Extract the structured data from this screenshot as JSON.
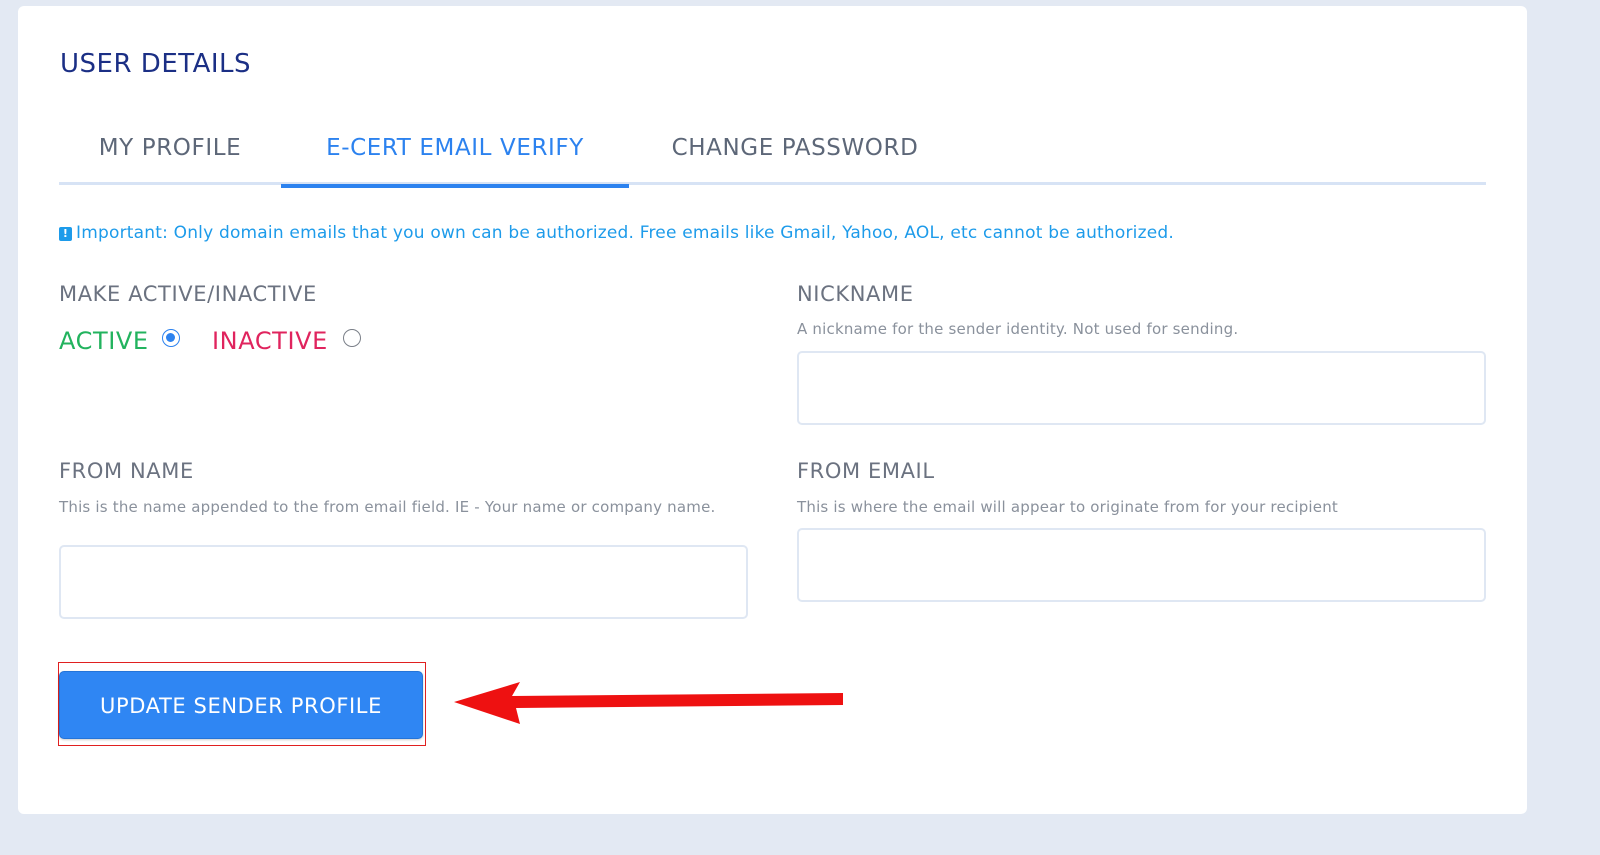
{
  "page": {
    "title": "USER DETAILS"
  },
  "tabs": [
    {
      "label": "MY PROFILE",
      "active": false
    },
    {
      "label": "E-CERT EMAIL VERIFY",
      "active": true
    },
    {
      "label": "CHANGE PASSWORD",
      "active": false
    }
  ],
  "notice": {
    "icon": "exclamation-icon",
    "text": "Important: Only domain emails that you own can be authorized. Free emails like Gmail, Yahoo, AOL, etc cannot be authorized."
  },
  "status": {
    "label": "MAKE ACTIVE/INACTIVE",
    "options": [
      {
        "label": "ACTIVE",
        "selected": true,
        "color": "#22b35e"
      },
      {
        "label": "INACTIVE",
        "selected": false,
        "color": "#e0245e"
      }
    ]
  },
  "nickname": {
    "label": "NICKNAME",
    "help": "A nickname for the sender identity. Not used for sending.",
    "value": ""
  },
  "from_name": {
    "label": "FROM NAME",
    "help": "This is the name appended to the from email field. IE - Your name or company name.",
    "value": ""
  },
  "from_email": {
    "label": "FROM EMAIL",
    "help": "This is where the email will appear to originate from for your recipient",
    "value": ""
  },
  "actions": {
    "update_label": "UPDATE SENDER PROFILE"
  },
  "annotations": {
    "arrow_color": "#ee1111",
    "highlight_color": "#e02020"
  },
  "colors": {
    "accent": "#2c82ef",
    "title": "#1b2f85",
    "notice": "#1d9bea"
  }
}
